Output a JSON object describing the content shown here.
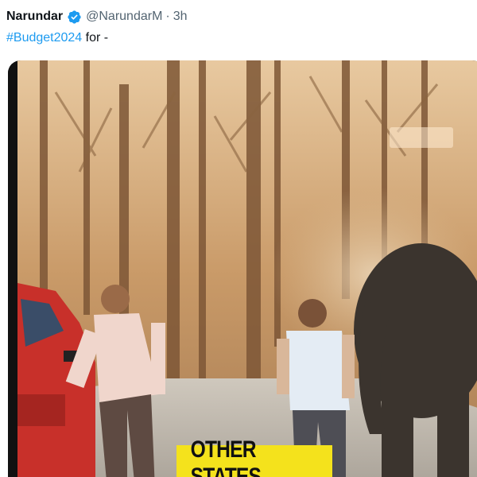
{
  "tweet": {
    "display_name": "Narundar",
    "verified_icon": "verified-badge-icon",
    "handle": "@NarundarM",
    "separator": "·",
    "time": "3h",
    "hashtag": "#Budget2024",
    "text_rest": " for -"
  },
  "media": {
    "caption": "OTHER STATES"
  },
  "colors": {
    "link": "#1d9bf0",
    "verified": "#1d9bf0",
    "caption_bg": "#f4e21c",
    "muted": "#536471"
  }
}
